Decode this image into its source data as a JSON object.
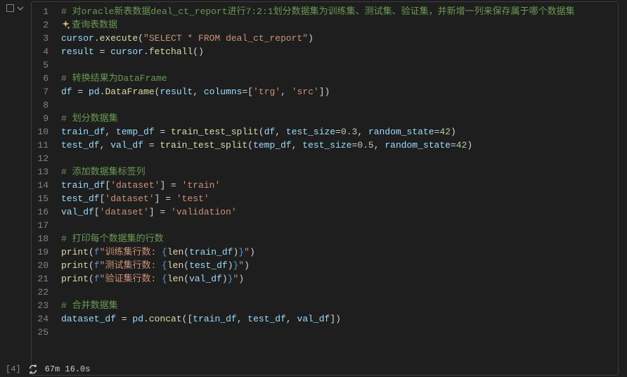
{
  "cell": {
    "execution_count": "[4]",
    "status_time": "67m 16.0s"
  },
  "lines": [
    {
      "num": "1",
      "tokens": [
        {
          "c": "c-comment",
          "t": "# 对oracle新表数据deal_ct_report进行7:2:1划分数据集为训练集、测试集、验证集，并新增一列来保存属于哪个数据集"
        }
      ]
    },
    {
      "num": "2",
      "tokens": [
        {
          "sparkle": true
        },
        {
          "c": "c-comment",
          "t": "查询表数据"
        }
      ]
    },
    {
      "num": "3",
      "tokens": [
        {
          "c": "c-var",
          "t": "cursor"
        },
        {
          "c": "c-punct",
          "t": "."
        },
        {
          "c": "c-func",
          "t": "execute"
        },
        {
          "c": "c-punct",
          "t": "("
        },
        {
          "c": "c-string",
          "t": "\"SELECT * FROM deal_ct_report\""
        },
        {
          "c": "c-punct",
          "t": ")"
        }
      ]
    },
    {
      "num": "4",
      "tokens": [
        {
          "c": "c-var",
          "t": "result"
        },
        {
          "c": "c-punct",
          "t": " = "
        },
        {
          "c": "c-var",
          "t": "cursor"
        },
        {
          "c": "c-punct",
          "t": "."
        },
        {
          "c": "c-func",
          "t": "fetchall"
        },
        {
          "c": "c-punct",
          "t": "()"
        }
      ]
    },
    {
      "num": "5",
      "tokens": []
    },
    {
      "num": "6",
      "tokens": [
        {
          "c": "c-comment",
          "t": "# 转换结果为DataFrame"
        }
      ]
    },
    {
      "num": "7",
      "tokens": [
        {
          "c": "c-var",
          "t": "df"
        },
        {
          "c": "c-punct",
          "t": " = "
        },
        {
          "c": "c-var",
          "t": "pd"
        },
        {
          "c": "c-punct",
          "t": "."
        },
        {
          "c": "c-func",
          "t": "DataFrame"
        },
        {
          "c": "c-punct",
          "t": "("
        },
        {
          "c": "c-var",
          "t": "result"
        },
        {
          "c": "c-punct",
          "t": ", "
        },
        {
          "c": "c-var",
          "t": "columns"
        },
        {
          "c": "c-punct",
          "t": "=["
        },
        {
          "c": "c-string",
          "t": "'trg'"
        },
        {
          "c": "c-punct",
          "t": ", "
        },
        {
          "c": "c-string",
          "t": "'src'"
        },
        {
          "c": "c-punct",
          "t": "])"
        }
      ]
    },
    {
      "num": "8",
      "tokens": []
    },
    {
      "num": "9",
      "tokens": [
        {
          "c": "c-comment",
          "t": "# 划分数据集"
        }
      ]
    },
    {
      "num": "10",
      "tokens": [
        {
          "c": "c-var",
          "t": "train_df"
        },
        {
          "c": "c-punct",
          "t": ", "
        },
        {
          "c": "c-var",
          "t": "temp_df"
        },
        {
          "c": "c-punct",
          "t": " = "
        },
        {
          "c": "c-func",
          "t": "train_test_split"
        },
        {
          "c": "c-punct",
          "t": "("
        },
        {
          "c": "c-var",
          "t": "df"
        },
        {
          "c": "c-punct",
          "t": ", "
        },
        {
          "c": "c-var",
          "t": "test_size"
        },
        {
          "c": "c-punct",
          "t": "="
        },
        {
          "c": "c-number",
          "t": "0.3"
        },
        {
          "c": "c-punct",
          "t": ", "
        },
        {
          "c": "c-var",
          "t": "random_state"
        },
        {
          "c": "c-punct",
          "t": "="
        },
        {
          "c": "c-number",
          "t": "42"
        },
        {
          "c": "c-punct",
          "t": ")"
        }
      ]
    },
    {
      "num": "11",
      "tokens": [
        {
          "c": "c-var",
          "t": "test_df"
        },
        {
          "c": "c-punct",
          "t": ", "
        },
        {
          "c": "c-var",
          "t": "val_df"
        },
        {
          "c": "c-punct",
          "t": " = "
        },
        {
          "c": "c-func",
          "t": "train_test_split"
        },
        {
          "c": "c-punct",
          "t": "("
        },
        {
          "c": "c-var",
          "t": "temp_df"
        },
        {
          "c": "c-punct",
          "t": ", "
        },
        {
          "c": "c-var",
          "t": "test_size"
        },
        {
          "c": "c-punct",
          "t": "="
        },
        {
          "c": "c-number",
          "t": "0.5"
        },
        {
          "c": "c-punct",
          "t": ", "
        },
        {
          "c": "c-var",
          "t": "random_state"
        },
        {
          "c": "c-punct",
          "t": "="
        },
        {
          "c": "c-number",
          "t": "42"
        },
        {
          "c": "c-punct",
          "t": ")"
        }
      ]
    },
    {
      "num": "12",
      "tokens": []
    },
    {
      "num": "13",
      "tokens": [
        {
          "c": "c-comment",
          "t": "# 添加数据集标签列"
        }
      ]
    },
    {
      "num": "14",
      "tokens": [
        {
          "c": "c-var",
          "t": "train_df"
        },
        {
          "c": "c-punct",
          "t": "["
        },
        {
          "c": "c-string",
          "t": "'dataset'"
        },
        {
          "c": "c-punct",
          "t": "] = "
        },
        {
          "c": "c-string",
          "t": "'train'"
        }
      ]
    },
    {
      "num": "15",
      "tokens": [
        {
          "c": "c-var",
          "t": "test_df"
        },
        {
          "c": "c-punct",
          "t": "["
        },
        {
          "c": "c-string",
          "t": "'dataset'"
        },
        {
          "c": "c-punct",
          "t": "] = "
        },
        {
          "c": "c-string",
          "t": "'test'"
        }
      ]
    },
    {
      "num": "16",
      "tokens": [
        {
          "c": "c-var",
          "t": "val_df"
        },
        {
          "c": "c-punct",
          "t": "["
        },
        {
          "c": "c-string",
          "t": "'dataset'"
        },
        {
          "c": "c-punct",
          "t": "] = "
        },
        {
          "c": "c-string",
          "t": "'validation'"
        }
      ]
    },
    {
      "num": "17",
      "tokens": []
    },
    {
      "num": "18",
      "tokens": [
        {
          "c": "c-comment",
          "t": "# 打印每个数据集的行数"
        }
      ]
    },
    {
      "num": "19",
      "tokens": [
        {
          "c": "c-func",
          "t": "print"
        },
        {
          "c": "c-punct",
          "t": "("
        },
        {
          "c": "c-keyword",
          "t": "f"
        },
        {
          "c": "c-string",
          "t": "\"训练集行数: "
        },
        {
          "c": "c-keyword",
          "t": "{"
        },
        {
          "c": "c-func",
          "t": "len"
        },
        {
          "c": "c-punct",
          "t": "("
        },
        {
          "c": "c-var",
          "t": "train_df"
        },
        {
          "c": "c-punct",
          "t": ")"
        },
        {
          "c": "c-keyword",
          "t": "}"
        },
        {
          "c": "c-string",
          "t": "\""
        },
        {
          "c": "c-punct",
          "t": ")"
        }
      ]
    },
    {
      "num": "20",
      "tokens": [
        {
          "c": "c-func",
          "t": "print"
        },
        {
          "c": "c-punct",
          "t": "("
        },
        {
          "c": "c-keyword",
          "t": "f"
        },
        {
          "c": "c-string",
          "t": "\"测试集行数: "
        },
        {
          "c": "c-keyword",
          "t": "{"
        },
        {
          "c": "c-func",
          "t": "len"
        },
        {
          "c": "c-punct",
          "t": "("
        },
        {
          "c": "c-var",
          "t": "test_df"
        },
        {
          "c": "c-punct",
          "t": ")"
        },
        {
          "c": "c-keyword",
          "t": "}"
        },
        {
          "c": "c-string",
          "t": "\""
        },
        {
          "c": "c-punct",
          "t": ")"
        }
      ]
    },
    {
      "num": "21",
      "tokens": [
        {
          "c": "c-func",
          "t": "print"
        },
        {
          "c": "c-punct",
          "t": "("
        },
        {
          "c": "c-keyword",
          "t": "f"
        },
        {
          "c": "c-string",
          "t": "\"验证集行数: "
        },
        {
          "c": "c-keyword",
          "t": "{"
        },
        {
          "c": "c-func",
          "t": "len"
        },
        {
          "c": "c-punct",
          "t": "("
        },
        {
          "c": "c-var",
          "t": "val_df"
        },
        {
          "c": "c-punct",
          "t": ")"
        },
        {
          "c": "c-keyword",
          "t": "}"
        },
        {
          "c": "c-string",
          "t": "\""
        },
        {
          "c": "c-punct",
          "t": ")"
        }
      ]
    },
    {
      "num": "22",
      "tokens": []
    },
    {
      "num": "23",
      "tokens": [
        {
          "c": "c-comment",
          "t": "# 合并数据集"
        }
      ]
    },
    {
      "num": "24",
      "tokens": [
        {
          "c": "c-var",
          "t": "dataset_df"
        },
        {
          "c": "c-punct",
          "t": " = "
        },
        {
          "c": "c-var",
          "t": "pd"
        },
        {
          "c": "c-punct",
          "t": "."
        },
        {
          "c": "c-func",
          "t": "concat"
        },
        {
          "c": "c-punct",
          "t": "(["
        },
        {
          "c": "c-var",
          "t": "train_df"
        },
        {
          "c": "c-punct",
          "t": ", "
        },
        {
          "c": "c-var",
          "t": "test_df"
        },
        {
          "c": "c-punct",
          "t": ", "
        },
        {
          "c": "c-var",
          "t": "val_df"
        },
        {
          "c": "c-punct",
          "t": "])"
        }
      ]
    },
    {
      "num": "25",
      "tokens": []
    }
  ]
}
